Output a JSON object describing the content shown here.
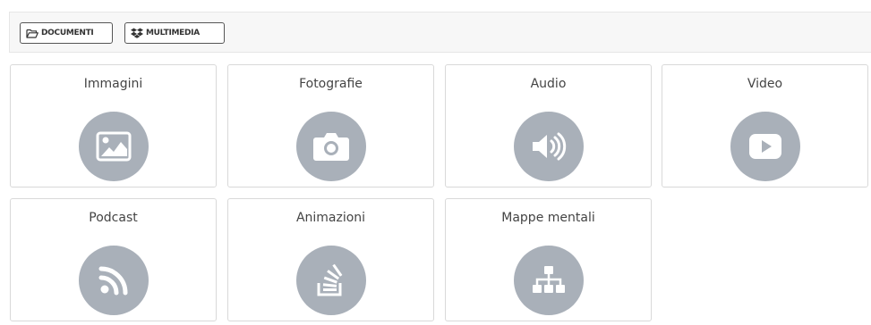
{
  "toolbar": {
    "documents_label": "DOCUMENTI",
    "documents_icon": "folder-open-icon",
    "multimedia_label": "MULTIMEDIA",
    "multimedia_icon": "dropbox-icon"
  },
  "categories": [
    {
      "label": "Immagini",
      "icon": "image-icon"
    },
    {
      "label": "Fotografie",
      "icon": "camera-icon"
    },
    {
      "label": "Audio",
      "icon": "volume-icon"
    },
    {
      "label": "Video",
      "icon": "play-icon"
    },
    {
      "label": "Podcast",
      "icon": "rss-icon"
    },
    {
      "label": "Animazioni",
      "icon": "stack-overflow-icon"
    },
    {
      "label": "Mappe mentali",
      "icon": "sitemap-icon"
    }
  ],
  "colors": {
    "icon_circle": "#a9b0b9",
    "card_border": "#d9d9d9",
    "toolbar_bg": "#f7f7f7"
  }
}
